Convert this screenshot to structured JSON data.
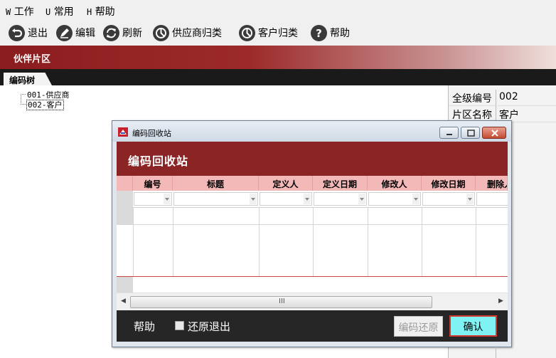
{
  "menu": {
    "items": [
      {
        "key": "W",
        "label": "工作"
      },
      {
        "key": "U",
        "label": "常用"
      },
      {
        "key": "H",
        "label": "帮助"
      }
    ]
  },
  "toolbar": {
    "exit": "退出",
    "edit": "编辑",
    "refresh": "刷新",
    "supplier_classify": "供应商归类",
    "customer_classify": "客户归类",
    "help": "帮助"
  },
  "section": {
    "title": "伙伴片区"
  },
  "tab": {
    "label": "编码树"
  },
  "tree": {
    "items": [
      {
        "label": "001-供应商",
        "selected": false
      },
      {
        "label": "002-客户",
        "selected": true
      }
    ]
  },
  "info": {
    "code_label": "全级编号",
    "code_value": "002",
    "name_label": "片区名称",
    "name_value": "客户"
  },
  "dialog": {
    "window_title": "编码回收站",
    "header": "编码回收站",
    "columns": [
      "编号",
      "标题",
      "定义人",
      "定义日期",
      "修改人",
      "修改日期",
      "删除人"
    ],
    "scroll_grip": "III",
    "footer": {
      "help": "帮助",
      "restore_exit_label": "还原退出",
      "restore_exit_checked": false,
      "restore_button": "编码还原",
      "confirm_button": "确认"
    }
  },
  "colors": {
    "section_red": "#8b1c1e",
    "dialog_header": "#8b2424",
    "grid_header": "#f3b8b8",
    "confirm_bg": "#7ff3f3",
    "confirm_border": "#d13a2e"
  }
}
